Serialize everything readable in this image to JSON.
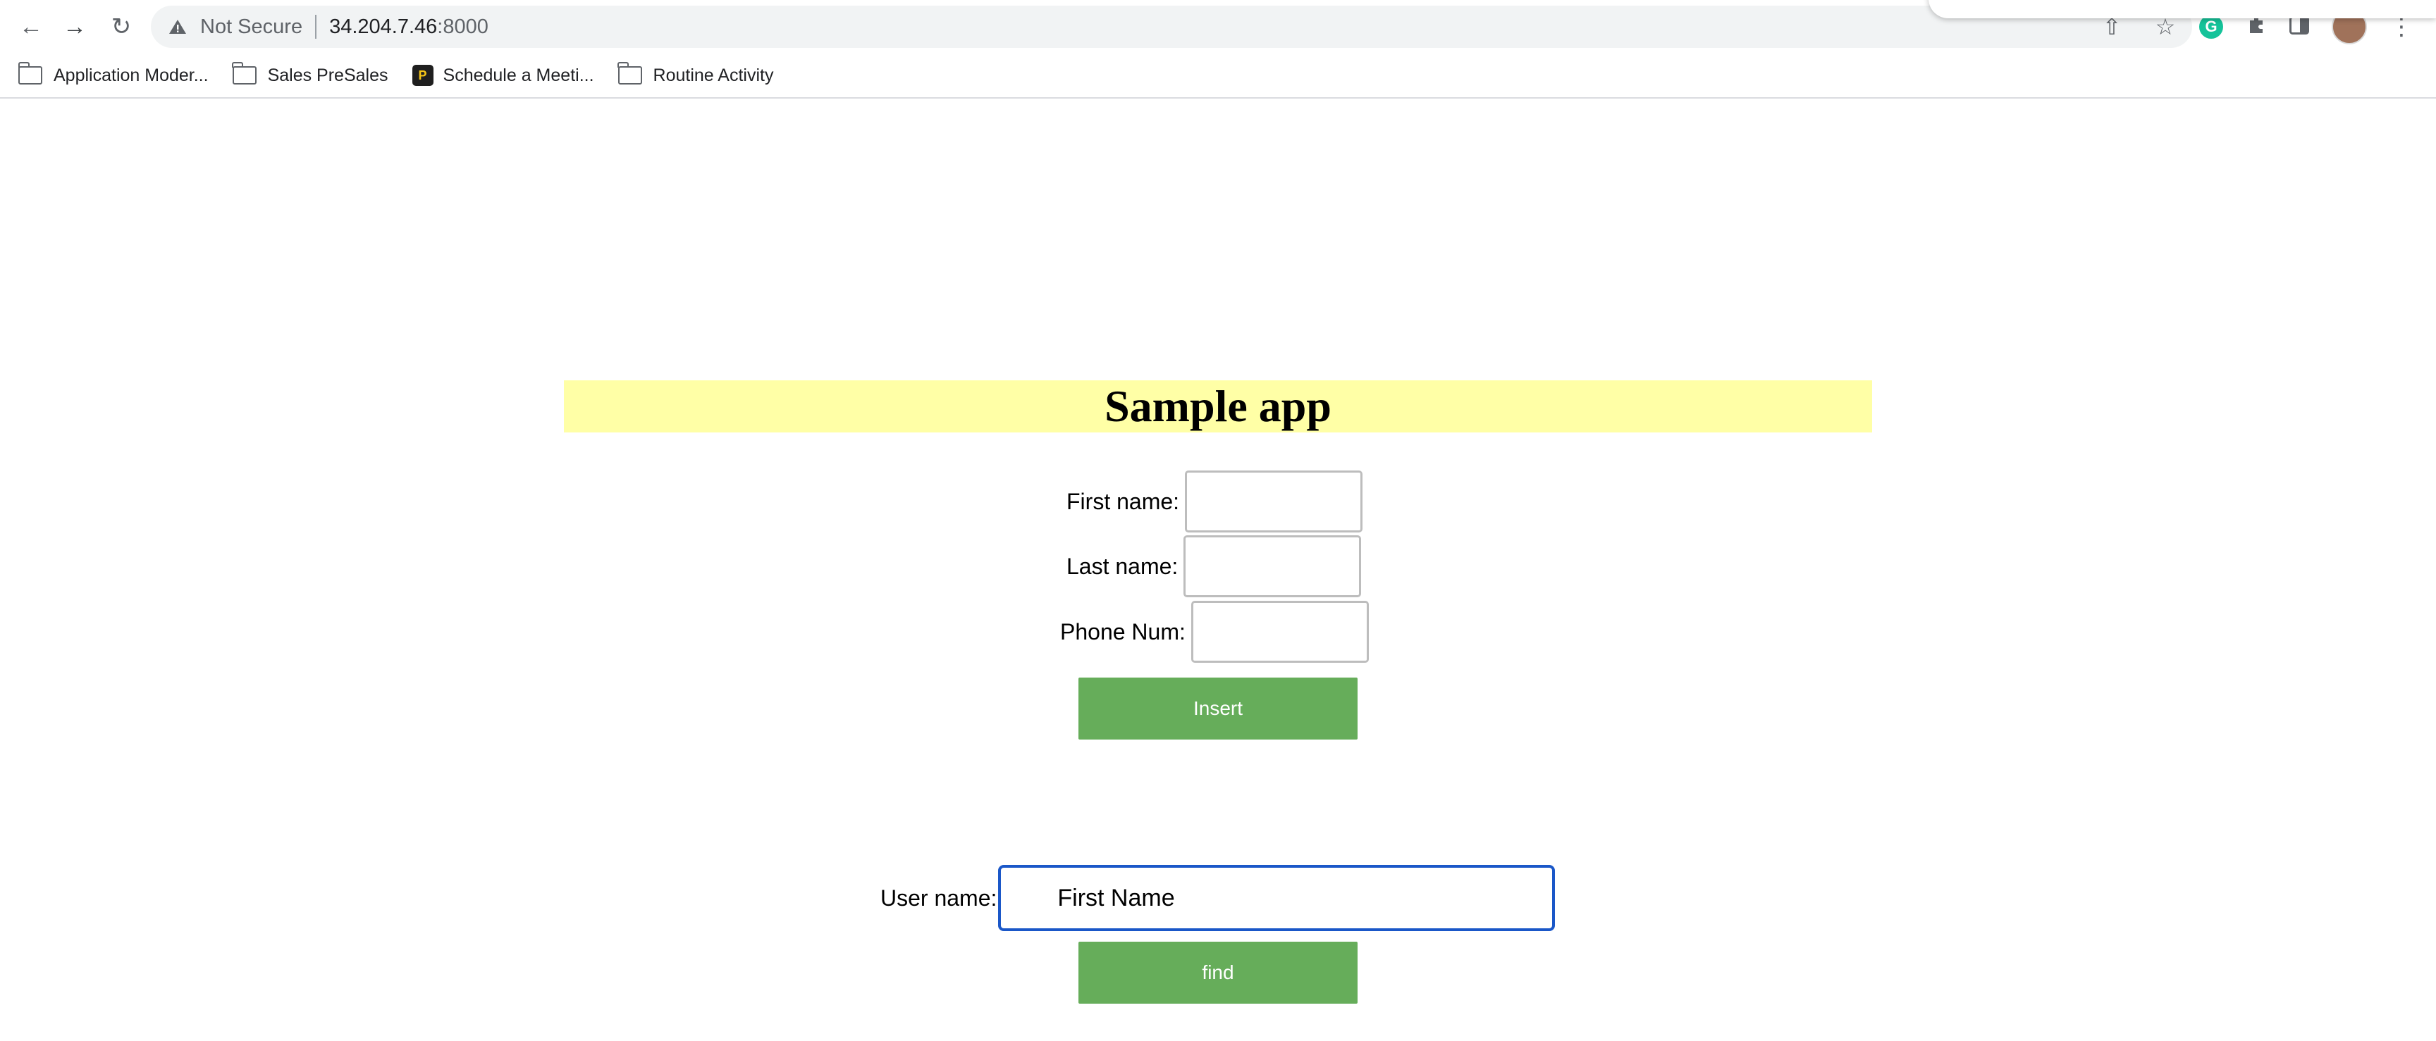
{
  "browser": {
    "security_label": "Not Secure",
    "url_host": "34.204.7.46",
    "url_port": ":8000",
    "bookmarks": [
      {
        "label": "Application Moder...",
        "icon": "folder-icon"
      },
      {
        "label": "Sales PreSales",
        "icon": "folder-icon"
      },
      {
        "label": "Schedule a Meeti...",
        "icon": "app-icon"
      },
      {
        "label": "Routine Activity",
        "icon": "folder-icon"
      }
    ],
    "extension_initial": "G"
  },
  "page": {
    "title": "Sample app",
    "form": {
      "first_name_label": "First name:",
      "last_name_label": "Last name:",
      "phone_label": "Phone Num:",
      "first_name_value": "",
      "last_name_value": "",
      "phone_value": "",
      "insert_label": "Insert"
    },
    "search": {
      "user_label": "User name:",
      "user_value": "First Name",
      "find_label": "find"
    }
  },
  "colors": {
    "banner": "#ffffa6",
    "button": "#66ad5a",
    "focus_border": "#1a57c8"
  }
}
